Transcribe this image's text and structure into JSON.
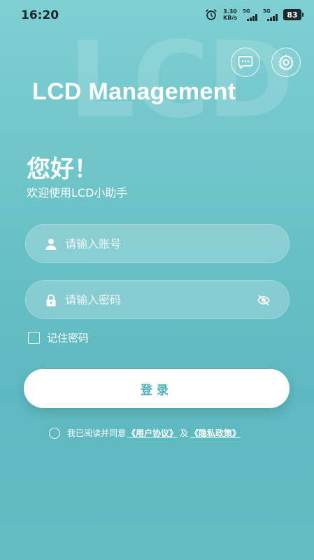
{
  "status_bar": {
    "time": "16:20",
    "speed_value": "3.30",
    "speed_unit": "KB/s",
    "net1": "5G",
    "net2": "5G",
    "battery": "83"
  },
  "watermark": "LCD",
  "header": {
    "app_title": "LCD Management",
    "chat_icon": "chat-bubble-icon",
    "settings_icon": "gear-icon"
  },
  "welcome": {
    "greeting": "您好！",
    "subtitle": "欢迎使用LCD小助手"
  },
  "form": {
    "account_placeholder": "请输入账号",
    "password_placeholder": "请输入密码",
    "remember_label": "记住密码",
    "login_label": "登录"
  },
  "agreement": {
    "prefix": "我已阅读并同意",
    "user_agreement": "《用户协议》",
    "conjunction": "及",
    "privacy_policy": "《隐私政策》"
  },
  "colors": {
    "background": "#6cc3c8",
    "button_text": "#4fb0b6"
  }
}
